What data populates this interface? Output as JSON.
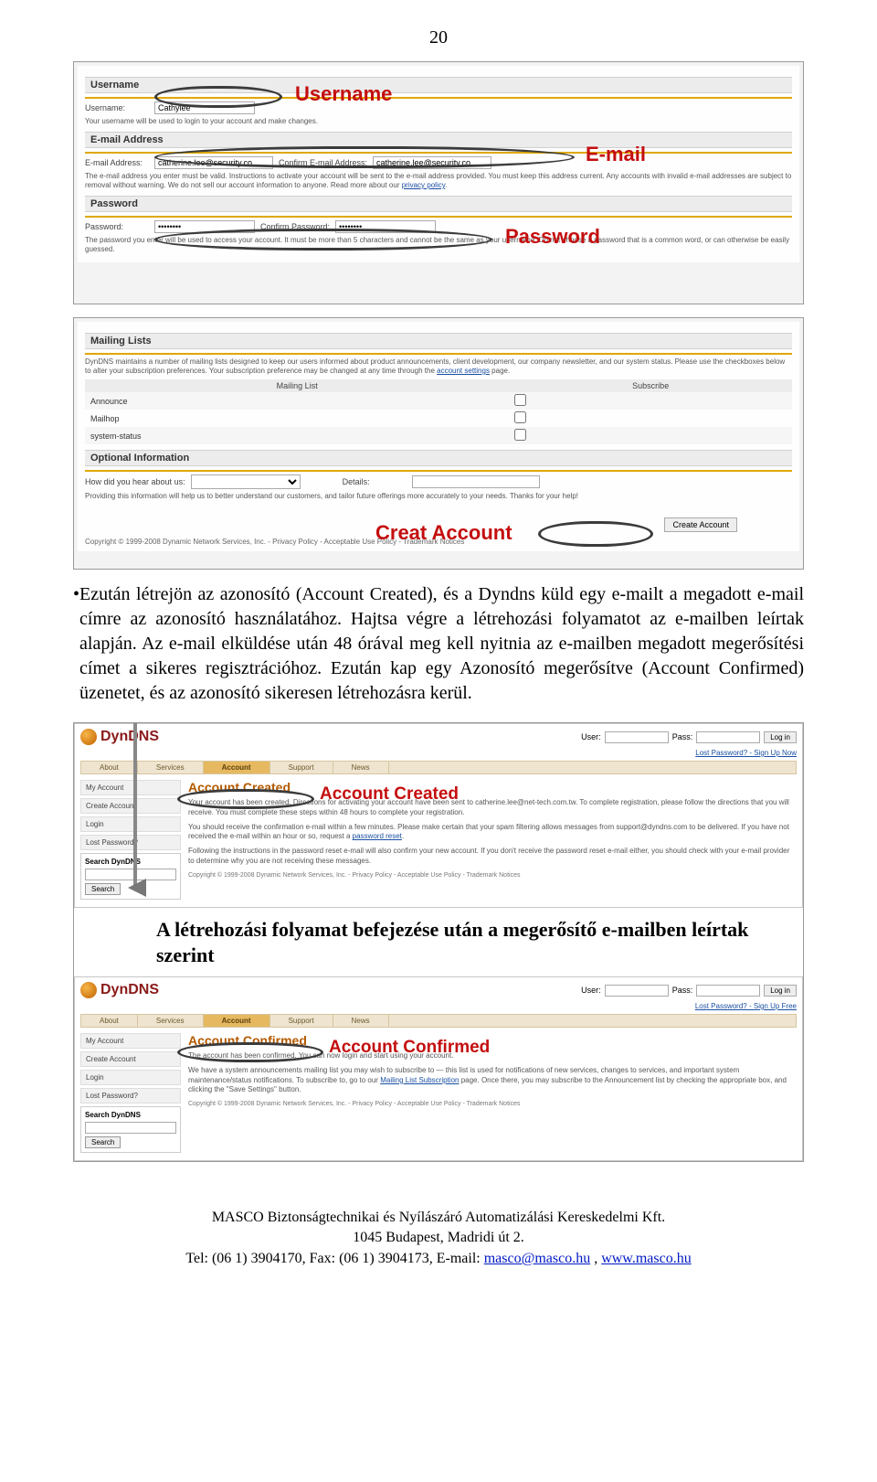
{
  "page_number": "20",
  "shot1": {
    "username_section": "Username",
    "username_label": "Username:",
    "username_value": "Cathylee",
    "username_help": "Your username will be used to login to your account and make changes.",
    "email_section": "E-mail Address",
    "email_label": "E-mail Address:",
    "email_value": "catherine.lee@security.co",
    "confirm_email_label": "Confirm E-mail Address:",
    "confirm_email_value": "catherine.lee@security.co",
    "email_help": "The e-mail address you enter must be valid. Instructions to activate your account will be sent to the e-mail address provided. You must keep this address current. Any accounts with invalid e-mail addresses are subject to removal without warning. We do not sell our account information to anyone. Read more about our ",
    "privacy_link": "privacy policy",
    "password_section": "Password",
    "password_label": "Password:",
    "confirm_password_label": "Confirm Password:",
    "password_help": "The password you enter will be used to access your account. It must be more than 5 characters and cannot be the same as your username. Do not choose a password that is a common word, or can otherwise be easily guessed.",
    "ann_username": "Username",
    "ann_email": "E-mail",
    "ann_password": "Password"
  },
  "shot2": {
    "mailing_section": "Mailing Lists",
    "mailing_help": "DynDNS maintains a number of mailing lists designed to keep our users informed about product announcements, client development, our company newsletter, and our system status. Please use the checkboxes below to alter your subscription preferences. Your subscription preference may be changed at any time through the ",
    "settings_link": "account settings",
    "mailing_after": " page.",
    "col_list": "Mailing List",
    "col_sub": "Subscribe",
    "rows": [
      "Announce",
      "Mailhop",
      "system-status"
    ],
    "optional_section": "Optional Information",
    "how_label": "How did you hear about us:",
    "details_label": "Details:",
    "optional_help": "Providing this information will help us to better understand our customers, and tailor future offerings more accurately to your needs. Thanks for your help!",
    "ann_create": "Creat Account",
    "create_btn": "Create Account",
    "copyright": "Copyright © 1999-2008 Dynamic Network Services, Inc. - Privacy Policy - Acceptable Use Policy - Trademark Notices"
  },
  "paragraph": "Ezután létrejön az azonosító (Account Created), és a Dyndns küld egy e-mailt a megadott e-mail címre az azonosító használatához. Hajtsa végre a létrehozási folyamatot az e-mailben leírtak alapján. Az e-mail elküldése után 48 órával meg kell nyitnia az e-mailben megadott megerősítési címet a sikeres regisztrációhoz. Ezután kap egy Azonosító megerősítve (Account Confirmed) üzenetet, és az azonosító sikeresen létrehozásra kerül.",
  "dyn": {
    "logo": "DynDNS",
    "user_label": "User:",
    "pass_label": "Pass:",
    "login_btn": "Log in",
    "lost_link_created": "Lost Password? - Sign Up Now",
    "lost_link_confirmed": "Lost Password? - Sign Up Free",
    "tabs": [
      "About",
      "Services",
      "Account",
      "Support",
      "News"
    ],
    "side_items": [
      "My Account",
      "Create Account",
      "Login",
      "Lost Password?"
    ],
    "search_head": "Search DynDNS",
    "search_btn": "Search",
    "created_title": "Account Created",
    "created_pill": "Account Created",
    "created_p1a": "Your account has been created. Directions for activating your account have been sent to catherine.lee@net-tech.com.tw. To complete registration, please follow the directions that you will receive. You must complete these steps within 48 hours to complete your registration.",
    "created_p2": "You should receive the confirmation e-mail within a few minutes. Please make certain that your spam filtering allows messages from support@dyndns.com to be delivered. If you have not received the e-mail within an hour or so, request a ",
    "pwreset": "password reset",
    "created_p3": "Following the instructions in the password reset e-mail will also confirm your new account. If you don't receive the password reset e-mail either, you should check with your e-mail provider to determine why you are not receiving these messages.",
    "created_foot": "Copyright © 1999-2008 Dynamic Network Services, Inc. - Privacy Policy - Acceptable Use Policy - Trademark Notices",
    "inter_text": "A létrehozási folyamat befejezése után a megerősítő e-mailben leírtak szerint",
    "confirmed_title": "Account Confirmed",
    "confirmed_pill": "Account Confirmed",
    "confirmed_p1": "The account has been confirmed. You can now login and start using your account.",
    "confirmed_p2a": "We have a system announcements mailing list you may wish to subscribe to — this list is used for notifications of new services, changes to services, and important system maintenance/status notifications. To subscribe to, go to our ",
    "ml_link": "Mailing List Subscription",
    "confirmed_p2b": " page. Once there, you may subscribe to the Announcement list by checking the appropriate box, and clicking the \"Save Settings\" button.",
    "confirmed_foot": "Copyright © 1999-2008 Dynamic Network Services, Inc. - Privacy Policy - Acceptable Use Policy - Trademark Notices"
  },
  "footer": {
    "line1": "MASCO Biztonságtechnikai és Nyílászáró Automatizálási Kereskedelmi Kft.",
    "line2": "1045 Budapest, Madridi út 2.",
    "line3a": "Tel: (06 1) 3904170, Fax: (06 1) 3904173, E-mail: ",
    "email": "masco@masco.hu",
    "line3b": ", ",
    "site": "www.masco.hu"
  }
}
